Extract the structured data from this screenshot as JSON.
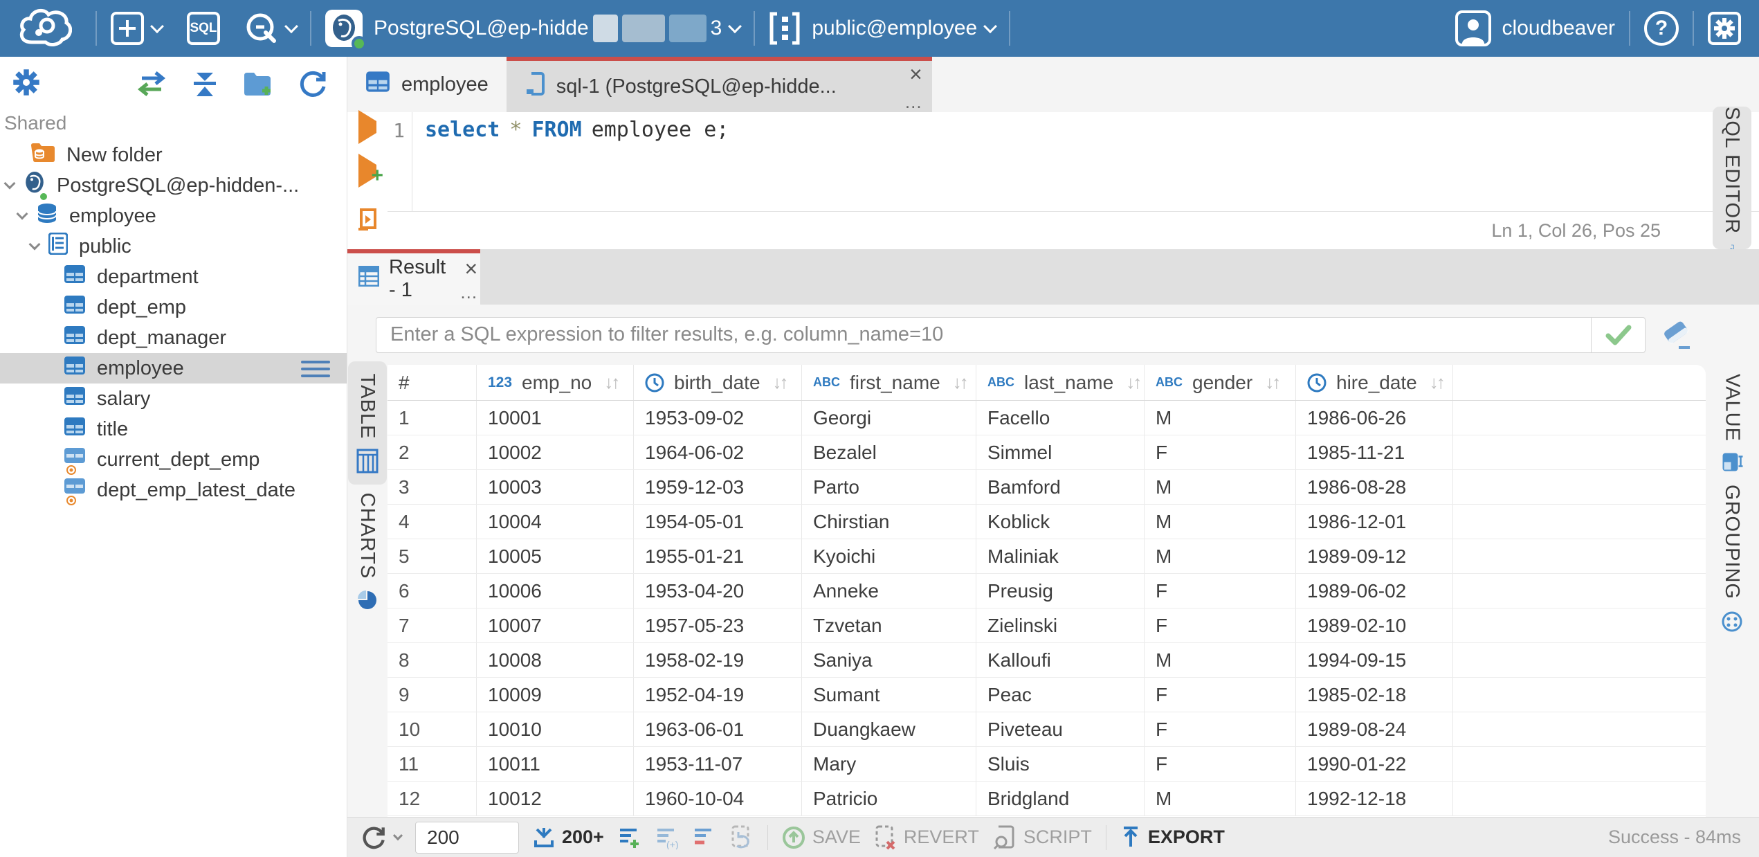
{
  "topbar": {
    "sql_button": "SQL",
    "connection": {
      "label": "PostgreSQL@ep-hidde",
      "suffix": "3"
    },
    "schema": {
      "label": "public@employee"
    },
    "user": {
      "label": "cloudbeaver"
    }
  },
  "sidebar": {
    "section_label": "Shared",
    "tree": [
      {
        "label": "New folder",
        "icon": "folder-database"
      },
      {
        "label": "PostgreSQL@ep-hidden-...",
        "icon": "postgresql-connection"
      },
      {
        "label": "employee",
        "icon": "database"
      },
      {
        "label": "public",
        "icon": "schema"
      },
      {
        "label": "department",
        "icon": "table"
      },
      {
        "label": "dept_emp",
        "icon": "table"
      },
      {
        "label": "dept_manager",
        "icon": "table"
      },
      {
        "label": "employee",
        "icon": "table",
        "selected": true
      },
      {
        "label": "salary",
        "icon": "table"
      },
      {
        "label": "title",
        "icon": "table"
      },
      {
        "label": "current_dept_emp",
        "icon": "view"
      },
      {
        "label": "dept_emp_latest_date",
        "icon": "view"
      }
    ]
  },
  "tabs": {
    "items": [
      {
        "label": "employee"
      },
      {
        "label": "sql-1 (PostgreSQL@ep-hidde..."
      }
    ]
  },
  "editor": {
    "line_number": "1",
    "sql": {
      "t1": "select",
      "t2": "*",
      "t3": "FROM",
      "t4": "employee e;"
    },
    "status": "Ln 1, Col 26, Pos 25",
    "side_tab": "SQL EDITOR"
  },
  "result": {
    "tab_label": "Result - 1",
    "filter_placeholder": "Enter a SQL expression to filter results, e.g. column_name=10",
    "left_tabs": [
      "TABLE",
      "CHARTS"
    ],
    "right_tabs": [
      "VALUE",
      "GROUPING"
    ]
  },
  "grid": {
    "row_header": "#",
    "sort_glyph": "↓↑",
    "columns": [
      {
        "icon_text": "123",
        "label": "emp_no",
        "type": "number"
      },
      {
        "icon_text": "",
        "label": "birth_date",
        "type": "datetime"
      },
      {
        "icon_text": "ABC",
        "label": "first_name",
        "type": "string"
      },
      {
        "icon_text": "ABC",
        "label": "last_name",
        "type": "string"
      },
      {
        "icon_text": "ABC",
        "label": "gender",
        "type": "string"
      },
      {
        "icon_text": "",
        "label": "hire_date",
        "type": "datetime"
      }
    ],
    "rows": [
      [
        "1",
        "10001",
        "1953-09-02",
        "Georgi",
        "Facello",
        "M",
        "1986-06-26"
      ],
      [
        "2",
        "10002",
        "1964-06-02",
        "Bezalel",
        "Simmel",
        "F",
        "1985-11-21"
      ],
      [
        "3",
        "10003",
        "1959-12-03",
        "Parto",
        "Bamford",
        "M",
        "1986-08-28"
      ],
      [
        "4",
        "10004",
        "1954-05-01",
        "Chirstian",
        "Koblick",
        "M",
        "1986-12-01"
      ],
      [
        "5",
        "10005",
        "1955-01-21",
        "Kyoichi",
        "Maliniak",
        "M",
        "1989-09-12"
      ],
      [
        "6",
        "10006",
        "1953-04-20",
        "Anneke",
        "Preusig",
        "F",
        "1989-06-02"
      ],
      [
        "7",
        "10007",
        "1957-05-23",
        "Tzvetan",
        "Zielinski",
        "F",
        "1989-02-10"
      ],
      [
        "8",
        "10008",
        "1958-02-19",
        "Saniya",
        "Kalloufi",
        "M",
        "1994-09-15"
      ],
      [
        "9",
        "10009",
        "1952-04-19",
        "Sumant",
        "Peac",
        "F",
        "1985-02-18"
      ],
      [
        "10",
        "10010",
        "1963-06-01",
        "Duangkaew",
        "Piveteau",
        "F",
        "1989-08-24"
      ],
      [
        "11",
        "10011",
        "1953-11-07",
        "Mary",
        "Sluis",
        "F",
        "1990-01-22"
      ],
      [
        "12",
        "10012",
        "1960-10-04",
        "Patricio",
        "Bridgland",
        "M",
        "1992-12-18"
      ]
    ]
  },
  "toolbar": {
    "rows_input": "200",
    "fetch_label": "200+",
    "save_label": "SAVE",
    "revert_label": "REVERT",
    "script_label": "SCRIPT",
    "export_label": "EXPORT",
    "status": "Success - 84ms"
  },
  "ui": {
    "close_glyph": "×",
    "more_glyph": "…",
    "colors": {
      "topbar": "#3d77ab",
      "accent_red": "#cb4e4a",
      "icon_blue": "#2e7ac0",
      "success_green": "#57b857"
    }
  }
}
